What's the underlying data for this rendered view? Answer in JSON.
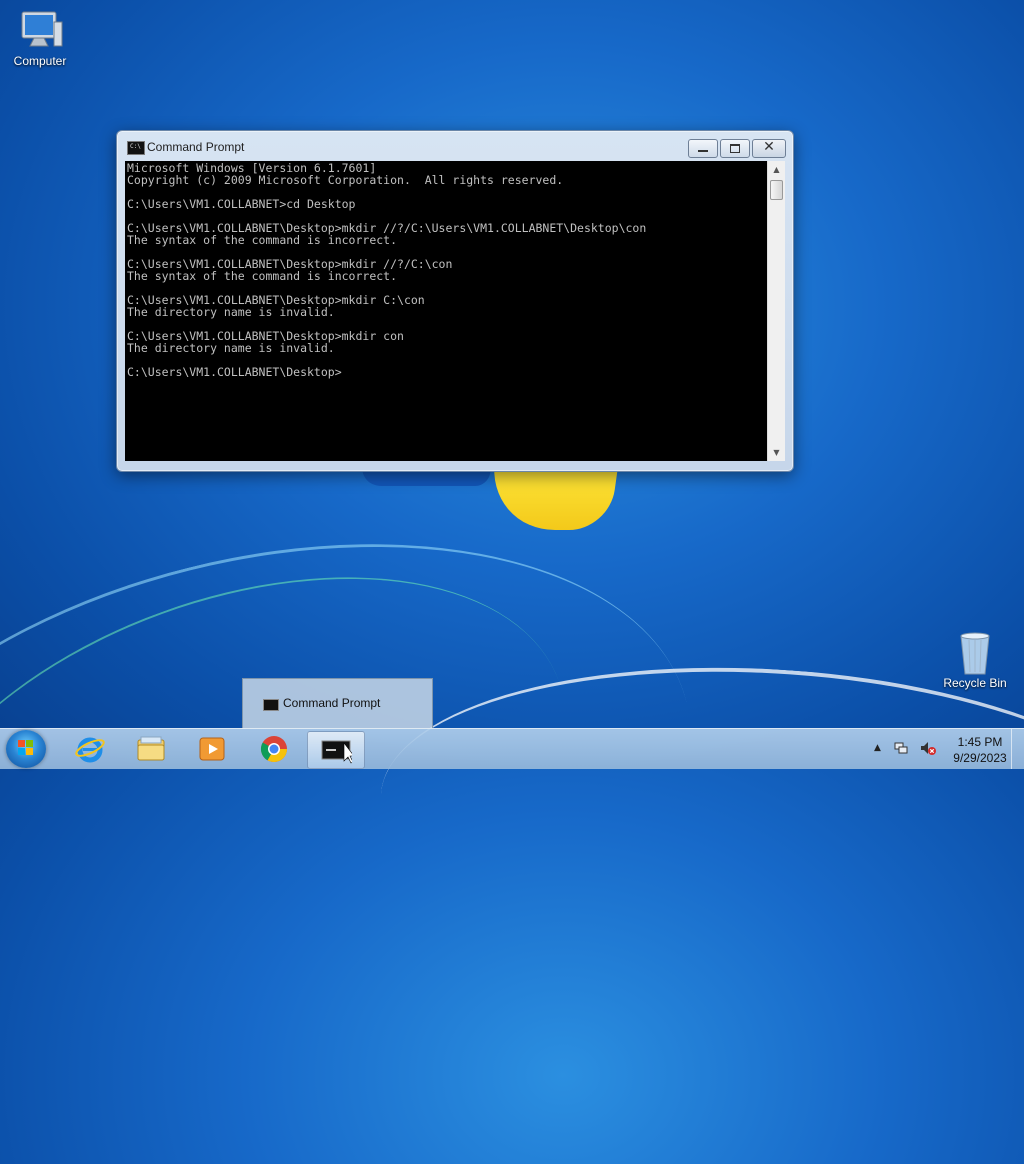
{
  "desktop": {
    "icons": [
      {
        "label": "Computer"
      },
      {
        "label": "Recycle Bin"
      }
    ]
  },
  "window": {
    "title": "Command Prompt",
    "close_glyph": "✕",
    "console_text": "Microsoft Windows [Version 6.1.7601]\nCopyright (c) 2009 Microsoft Corporation.  All rights reserved.\n\nC:\\Users\\VM1.COLLABNET>cd Desktop\n\nC:\\Users\\VM1.COLLABNET\\Desktop>mkdir //?/C:\\Users\\VM1.COLLABNET\\Desktop\\con\nThe syntax of the command is incorrect.\n\nC:\\Users\\VM1.COLLABNET\\Desktop>mkdir //?/C:\\con\nThe syntax of the command is incorrect.\n\nC:\\Users\\VM1.COLLABNET\\Desktop>mkdir C:\\con\nThe directory name is invalid.\n\nC:\\Users\\VM1.COLLABNET\\Desktop>mkdir con\nThe directory name is invalid.\n\nC:\\Users\\VM1.COLLABNET\\Desktop>",
    "scroll_up": "▲",
    "scroll_down": "▼"
  },
  "popup": {
    "label": "Command Prompt"
  },
  "taskbar": {
    "pinned": [
      {
        "name": "internet-explorer-icon"
      },
      {
        "name": "windows-explorer-icon"
      },
      {
        "name": "media-player-icon"
      },
      {
        "name": "chrome-icon"
      },
      {
        "name": "command-prompt-icon"
      }
    ],
    "tray_arrow": "▲",
    "clock": {
      "time": "1:45 PM",
      "date": "9/29/2023"
    }
  },
  "colors": {
    "console_bg": "#000000",
    "console_fg": "#c0c0c0",
    "desktop_blue": "#1769c9"
  }
}
